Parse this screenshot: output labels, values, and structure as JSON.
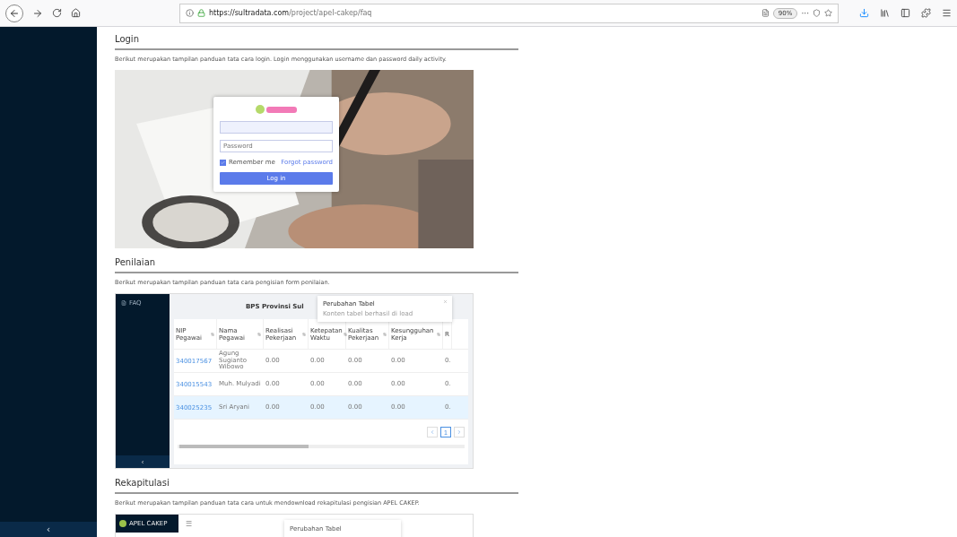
{
  "browser": {
    "url_host": "https://sultradata.com",
    "url_path": "/project/apel-cakep/faq",
    "zoom": "90%",
    "more": "···"
  },
  "sidebar": {
    "collapse": "‹"
  },
  "sections": [
    {
      "title": "Login",
      "description": "Berikut merupakan tampilan panduan tata cara login. Login menggunakan username dan password daily activity.",
      "shot": {
        "kind": "login",
        "password_placeholder": "Password",
        "remember": "Remember me",
        "remember_checked": true,
        "forgot": "Forgot password",
        "button": "Log in"
      }
    },
    {
      "title": "Penilaian",
      "description": "Berikut merupakan tampilan panduan tata cara pengisian form penilaian.",
      "shot": {
        "kind": "table",
        "menu_item": "FAQ",
        "title": "BPS Provinsi Sul",
        "toast": {
          "title": "Perubahan Tabel",
          "message": "Konten tabel berhasil di load"
        },
        "columns": [
          "NIP Pegawai",
          "Nama Pegawai",
          "Realisasi Pekerjaan",
          "Ketepatan Waktu",
          "Kualitas Pekerjaan",
          "Kesungguhan Kerja",
          "R"
        ],
        "rows": [
          {
            "nip": "340017567",
            "name": "Agung Sugianto Wibowo",
            "values": [
              "0.00",
              "0.00",
              "0.00",
              "0.00",
              "0."
            ],
            "selected": false
          },
          {
            "nip": "340015543",
            "name": "Muh. Mulyadi",
            "values": [
              "0.00",
              "0.00",
              "0.00",
              "0.00",
              "0."
            ],
            "selected": false
          },
          {
            "nip": "340025235",
            "name": "Sri Aryani",
            "values": [
              "0.00",
              "0.00",
              "0.00",
              "0.00",
              "0."
            ],
            "selected": true
          }
        ],
        "page": "1",
        "collapse": "‹"
      }
    },
    {
      "title": "Rekapitulasi",
      "description": "Berikut merupakan tampilan panduan tata cara untuk mendownload rekapitulasi pengisian APEL CAKEP.",
      "shot": {
        "kind": "recap",
        "logo": "APEL CAKEP",
        "menu": "☰",
        "toast": "Perubahan Tabel"
      }
    }
  ]
}
